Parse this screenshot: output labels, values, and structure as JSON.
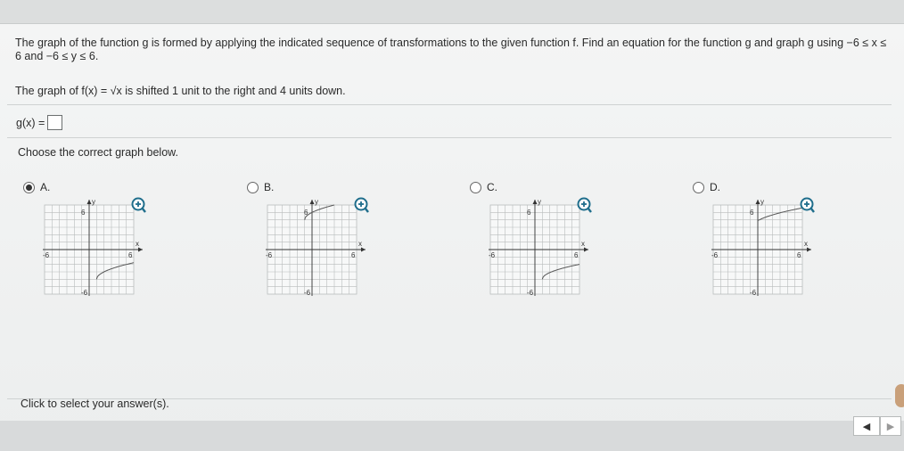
{
  "problem": {
    "statement": "The graph of the function g is formed by applying the indicated sequence of transformations to the given function f. Find an equation for the function g and graph g using −6 ≤ x ≤ 6 and −6 ≤ y ≤ 6.",
    "transformation": "The graph of f(x) = √x is shifted 1 unit to the right and 4 units down.",
    "gx_label": "g(x) =",
    "choose_prompt": "Choose the correct graph below."
  },
  "options": [
    {
      "label": "A.",
      "selected": true
    },
    {
      "label": "B.",
      "selected": false
    },
    {
      "label": "C.",
      "selected": false
    },
    {
      "label": "D.",
      "selected": false
    }
  ],
  "graph_labels": {
    "x": "x",
    "y": "y",
    "pos": "6",
    "neg": "-6"
  },
  "footer": {
    "status": "Click to select your answer(s)."
  },
  "icons": {
    "zoom": "zoom-in-icon",
    "nav_prev": "triangle-left-icon",
    "nav_next": "triangle-right-icon"
  },
  "colors": {
    "accent": "#1f6e8c",
    "grid": "#b8bcbc",
    "curve": "#555555"
  }
}
